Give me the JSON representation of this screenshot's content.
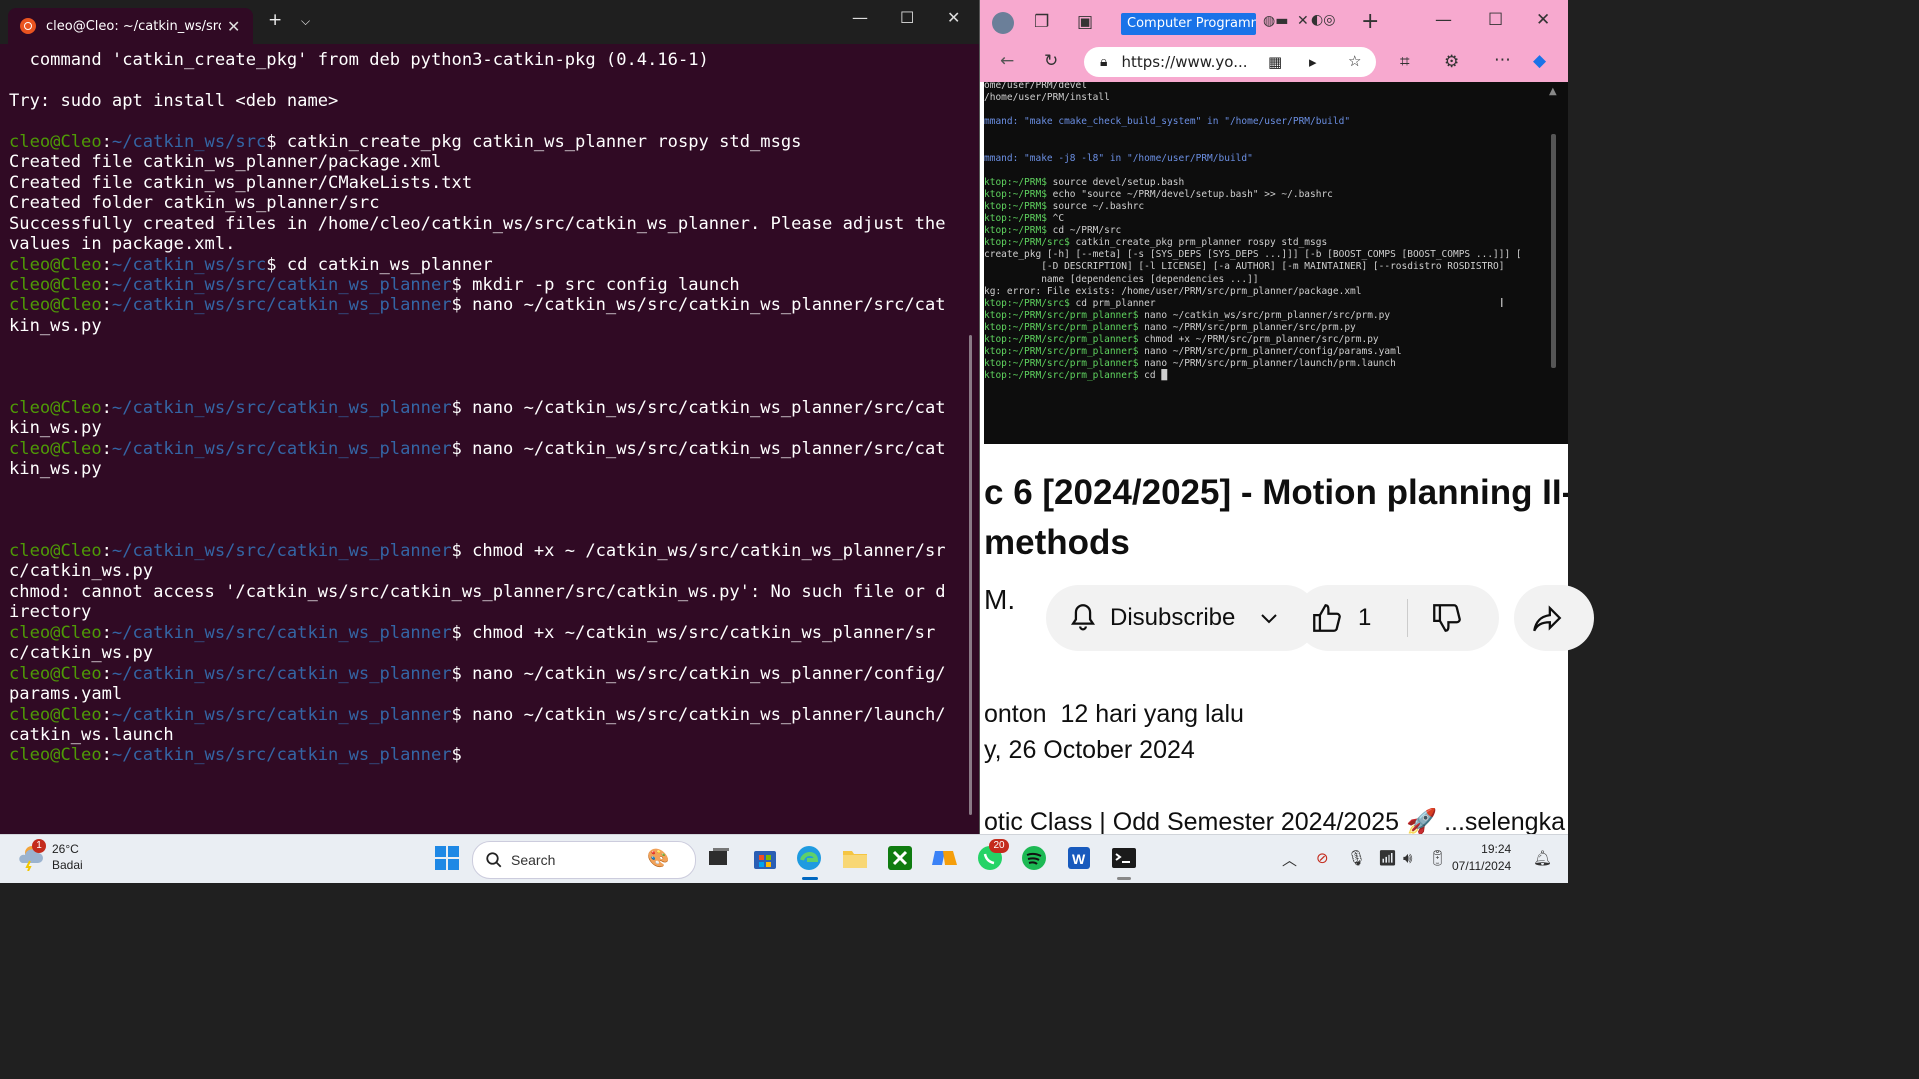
{
  "terminal": {
    "tab_title": "cleo@Cleo: ~/catkin_ws/src/c",
    "lines": [
      {
        "text": "  command 'catkin_create_pkg' from deb python3-catkin-pkg (0.4.16-1)"
      },
      {
        "text": ""
      },
      {
        "text": "Try: sudo apt install <deb name>"
      },
      {
        "text": ""
      },
      {
        "user": "cleo@Cleo",
        "path": "~/catkin_ws/src",
        "cmd": "catkin_create_pkg catkin_ws_planner rospy std_msgs"
      },
      {
        "text": "Created file catkin_ws_planner/package.xml"
      },
      {
        "text": "Created file catkin_ws_planner/CMakeLists.txt"
      },
      {
        "text": "Created folder catkin_ws_planner/src"
      },
      {
        "text": "Successfully created files in /home/cleo/catkin_ws/src/catkin_ws_planner. Please adjust the values in package.xml."
      },
      {
        "user": "cleo@Cleo",
        "path": "~/catkin_ws/src",
        "cmd": "cd catkin_ws_planner"
      },
      {
        "user": "cleo@Cleo",
        "path": "~/catkin_ws/src/catkin_ws_planner",
        "cmd": "mkdir -p src config launch"
      },
      {
        "user": "cleo@Cleo",
        "path": "~/catkin_ws/src/catkin_ws_planner",
        "cmd": "nano ~/catkin_ws/src/catkin_ws_planner/src/catkin_ws.py"
      },
      {
        "text": ""
      },
      {
        "text": ""
      },
      {
        "text": ""
      },
      {
        "user": "cleo@Cleo",
        "path": "~/catkin_ws/src/catkin_ws_planner",
        "cmd": "nano ~/catkin_ws/src/catkin_ws_planner/src/catkin_ws.py"
      },
      {
        "user": "cleo@Cleo",
        "path": "~/catkin_ws/src/catkin_ws_planner",
        "cmd": "nano ~/catkin_ws/src/catkin_ws_planner/src/catkin_ws.py"
      },
      {
        "text": ""
      },
      {
        "text": ""
      },
      {
        "text": ""
      },
      {
        "user": "cleo@Cleo",
        "path": "~/catkin_ws/src/catkin_ws_planner",
        "cmd": "chmod +x ~ /catkin_ws/src/catkin_ws_planner/src/catkin_ws.py"
      },
      {
        "text": "chmod: cannot access '/catkin_ws/src/catkin_ws_planner/src/catkin_ws.py': No such file or directory"
      },
      {
        "user": "cleo@Cleo",
        "path": "~/catkin_ws/src/catkin_ws_planner",
        "cmd": "chmod +x ~/catkin_ws/src/catkin_ws_planner/src/catkin_ws.py"
      },
      {
        "user": "cleo@Cleo",
        "path": "~/catkin_ws/src/catkin_ws_planner",
        "cmd": "nano ~/catkin_ws/src/catkin_ws_planner/config/params.yaml"
      },
      {
        "user": "cleo@Cleo",
        "path": "~/catkin_ws/src/catkin_ws_planner",
        "cmd": "nano ~/catkin_ws/src/catkin_ws_planner/launch/catkin_ws.launch"
      },
      {
        "user": "cleo@Cleo",
        "path": "~/catkin_ws/src/catkin_ws_planner",
        "cmd": ""
      }
    ]
  },
  "browser": {
    "tab_title": "Computer Programmi",
    "url": "https://www.yo...",
    "video_lines": [
      {
        "text": "ome/user/PRM/devel"
      },
      {
        "text": "/home/user/PRM/install"
      },
      {
        "text": ""
      },
      {
        "text": "mmand: \"make cmake_check_build_system\" in \"/home/user/PRM/build\"",
        "c": "b"
      },
      {
        "text": ""
      },
      {
        "text": ""
      },
      {
        "text": "mmand: \"make -j8 -l8\" in \"/home/user/PRM/build\"",
        "c": "b"
      },
      {
        "text": ""
      },
      {
        "p": "ktop:~/PRM$",
        "cmd": " source devel/setup.bash"
      },
      {
        "p": "ktop:~/PRM$",
        "cmd": " echo \"source ~/PRM/devel/setup.bash\" >> ~/.bashrc"
      },
      {
        "p": "ktop:~/PRM$",
        "cmd": " source ~/.bashrc"
      },
      {
        "p": "ktop:~/PRM$",
        "cmd": " ^C"
      },
      {
        "p": "ktop:~/PRM$",
        "cmd": " cd ~/PRM/src"
      },
      {
        "p": "ktop:~/PRM/src$",
        "cmd": " catkin_create_pkg prm_planner rospy std_msgs"
      },
      {
        "text": "create_pkg [-h] [--meta] [-s [SYS_DEPS [SYS_DEPS ...]]] [-b [BOOST_COMPS [BOOST_COMPS ...]]] ["
      },
      {
        "text": "          [-D DESCRIPTION] [-l LICENSE] [-a AUTHOR] [-m MAINTAINER] [--rosdistro ROSDISTRO]"
      },
      {
        "text": "          name [dependencies [dependencies ...]]"
      },
      {
        "text": "kg: error: File exists: /home/user/PRM/src/prm_planner/package.xml"
      },
      {
        "p": "ktop:~/PRM/src$",
        "cmd": " cd prm_planner"
      },
      {
        "p": "ktop:~/PRM/src/prm_planner$",
        "cmd": " nano ~/catkin_ws/src/prm_planner/src/prm.py"
      },
      {
        "p": "ktop:~/PRM/src/prm_planner$",
        "cmd": " nano ~/PRM/src/prm_planner/src/prm.py"
      },
      {
        "p": "ktop:~/PRM/src/prm_planner$",
        "cmd": " chmod +x ~/PRM/src/prm_planner/src/prm.py"
      },
      {
        "p": "ktop:~/PRM/src/prm_planner$",
        "cmd": " nano ~/PRM/src/prm_planner/config/params.yaml"
      },
      {
        "p": "ktop:~/PRM/src/prm_planner$",
        "cmd": " nano ~/PRM/src/prm_planner/launch/prm.launch"
      },
      {
        "p": "ktop:~/PRM/src/prm_planner$",
        "cmd": " cd █"
      }
    ],
    "video_title": "c 6 [2024/2025] - Motion planning II-\nmethods",
    "channel_initial": "M.",
    "subscribe_label": "Disubscribe",
    "like_count": "1",
    "meta_line1": "onton  12 hari yang lalu",
    "meta_line2": "y, 26 October 2024",
    "description": "otic Class | Odd Semester 2024/2025 🚀 ...selengka"
  },
  "taskbar": {
    "weather_temp": "26°C",
    "weather_desc": "Badai",
    "weather_badge": "1",
    "search_label": "Search",
    "whatsapp_badge": "20",
    "time": "19:24",
    "date": "07/11/2024"
  }
}
